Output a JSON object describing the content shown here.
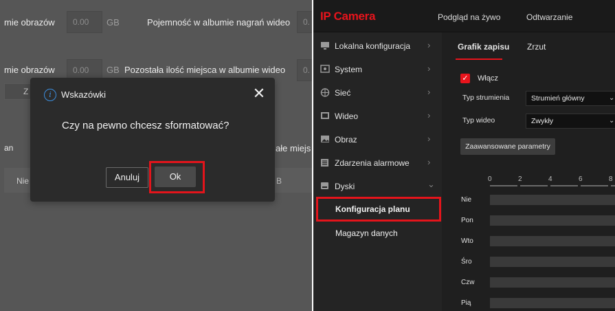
{
  "left": {
    "row1": {
      "label_left": "mie obrazów",
      "value": "0.00",
      "unit": "GB",
      "label_right": "Pojemność w albumie nagrań wideo",
      "value_right_partial": "0."
    },
    "row2": {
      "label_left": "mie obrazów",
      "value": "0.00",
      "unit": "GB",
      "label_right": "Pozostała ilość miejsca w albumie wideo",
      "value_right_partial": "0."
    },
    "bg_btn_partial": "Z",
    "bg_text_an": "an",
    "bg_text_ale_miejs": "ałe miejs",
    "bg_text_nie": "Nie",
    "bg_text_b": "B",
    "dialog": {
      "icon": "info-icon",
      "title": "Wskazówki",
      "close": "✕",
      "message": "Czy na pewno chcesz sformatować?",
      "cancel_label": "Anuluj",
      "ok_label": "Ok",
      "highlight_color": "#e4141b"
    }
  },
  "right": {
    "brand": "IP Camera",
    "top_nav": [
      "Podgląd na żywo",
      "Odtwarzanie"
    ],
    "sidebar": [
      {
        "icon": "monitor-icon",
        "label": "Lokalna konfiguracja",
        "arrow": "›"
      },
      {
        "icon": "system-icon",
        "label": "System",
        "arrow": "›"
      },
      {
        "icon": "network-icon",
        "label": "Sieć",
        "arrow": "›"
      },
      {
        "icon": "video-icon",
        "label": "Wideo",
        "arrow": "›"
      },
      {
        "icon": "image-icon",
        "label": "Obraz",
        "arrow": "›"
      },
      {
        "icon": "alarm-icon",
        "label": "Zdarzenia alarmowe",
        "arrow": "›"
      },
      {
        "icon": "disk-icon",
        "label": "Dyski",
        "arrow": "⌄"
      }
    ],
    "submenu": [
      {
        "label": "Konfiguracja planu",
        "highlighted": true
      },
      {
        "label": "Magazyn danych"
      }
    ],
    "tabs": [
      {
        "label": "Grafik zapisu",
        "active": true
      },
      {
        "label": "Zrzut"
      }
    ],
    "enable_label": "Włącz",
    "stream_type": {
      "label": "Typ strumienia",
      "value": "Strumień główny"
    },
    "video_type": {
      "label": "Typ wideo",
      "value": "Zwykły"
    },
    "advanced_label": "Zaawansowane parametry",
    "ticks": [
      "0",
      "2",
      "4",
      "6",
      "8"
    ],
    "days": [
      "Nie",
      "Pon",
      "Wto",
      "Śro",
      "Czw",
      "Pią"
    ],
    "accent_color": "#e8141c"
  }
}
